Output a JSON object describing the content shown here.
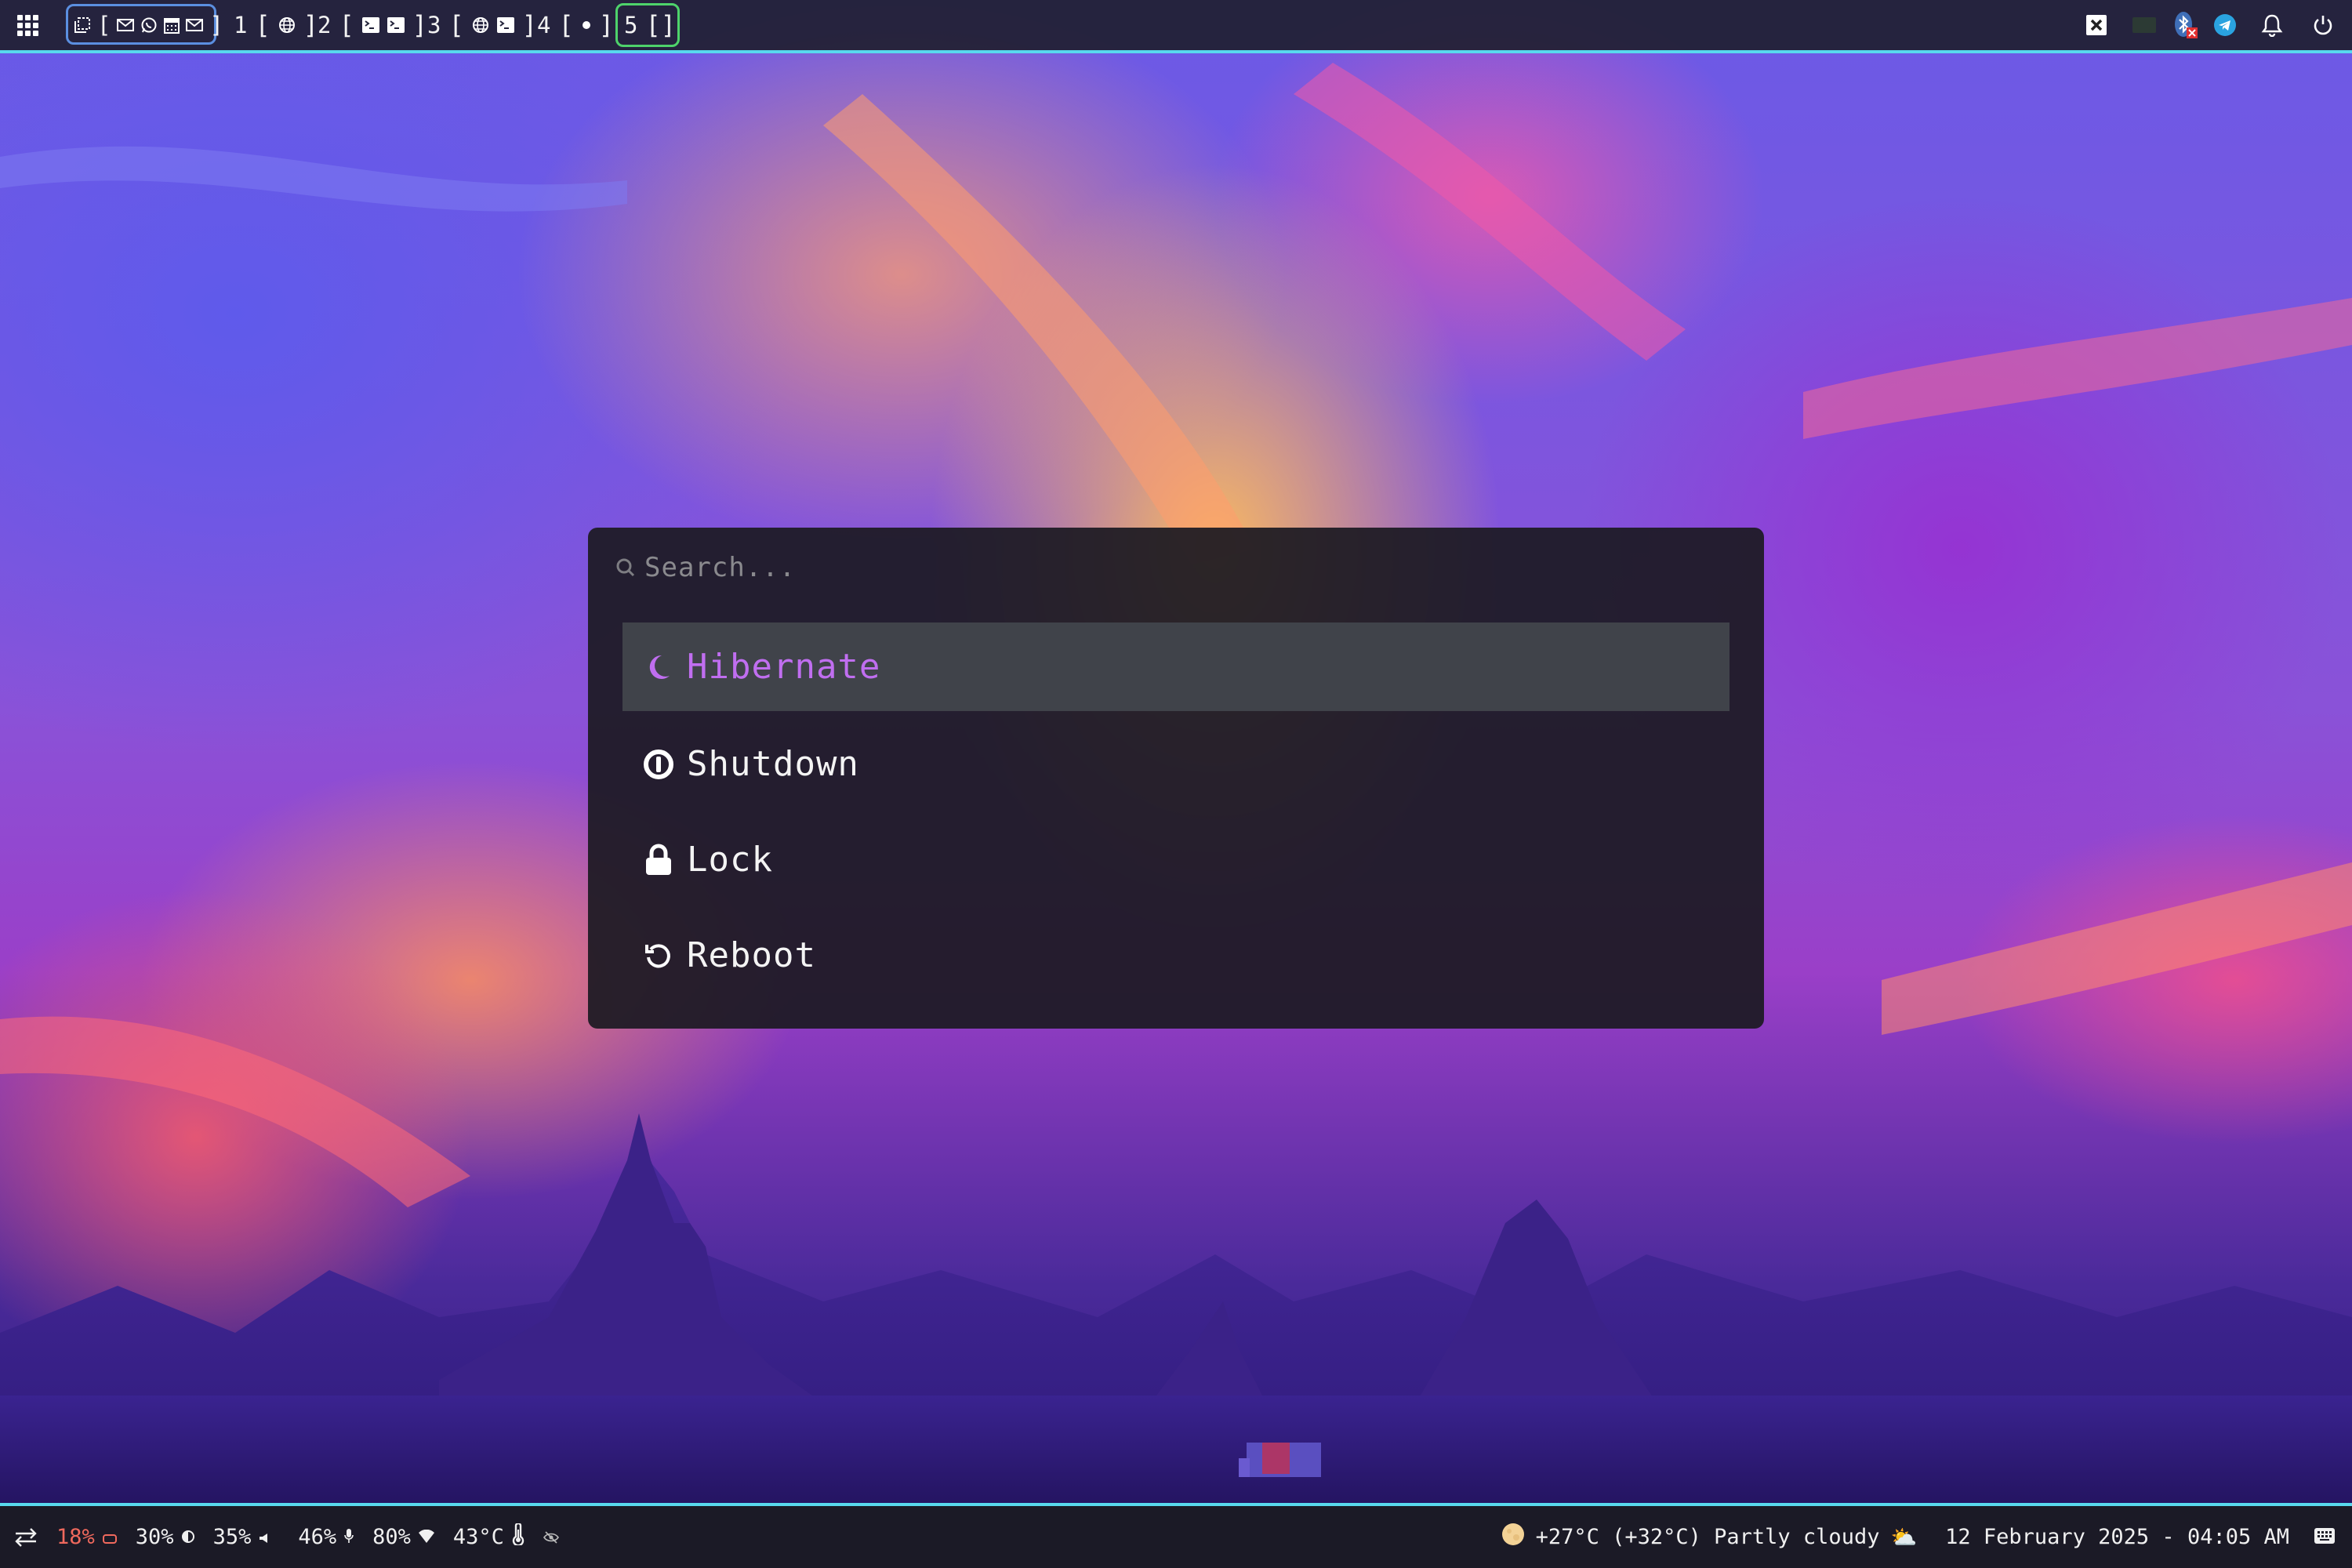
{
  "topbar": {
    "launcher_icon": "apps-grid-icon",
    "scratchpad": {
      "icon": "scratchpad-icon",
      "apps": [
        "mail-icon",
        "whatsapp-icon",
        "calendar-icon",
        "mail-icon"
      ],
      "bracket_open": "[",
      "bracket_close": "]"
    },
    "workspaces": [
      {
        "number": "1",
        "apps": [
          "globe-icon"
        ],
        "active": false
      },
      {
        "number": "2",
        "apps": [
          "terminal-icon",
          "terminal-icon"
        ],
        "active": false
      },
      {
        "number": "3",
        "apps": [
          "globe-icon",
          "terminal-icon"
        ],
        "active": false
      },
      {
        "number": "4",
        "apps": [
          "dot-icon"
        ],
        "active": false
      },
      {
        "number": "5",
        "apps": [],
        "active": true
      }
    ],
    "tray": [
      "close-window-icon",
      "keyboard-layout-icon",
      "bluetooth-disconnected-icon",
      "telegram-icon",
      "notification-bell-icon",
      "power-icon"
    ],
    "colors": {
      "scratch_border": "#5b8fe0",
      "active_border": "#4ed36b",
      "accent_line": "#58d8ee"
    }
  },
  "menu": {
    "search_placeholder": "Search...",
    "search_value": "",
    "items": [
      {
        "label": "Hibernate",
        "icon": "moon-icon",
        "selected": true
      },
      {
        "label": "Shutdown",
        "icon": "power-off-icon",
        "selected": false
      },
      {
        "label": "Lock",
        "icon": "lock-icon",
        "selected": false
      },
      {
        "label": "Reboot",
        "icon": "reboot-icon",
        "selected": false
      }
    ],
    "colors": {
      "selected_text": "#c06ef0",
      "selected_bg": "#40434a"
    }
  },
  "bottombar": {
    "left": {
      "swap_icon": "swap-arrows-icon",
      "battery": {
        "value": "18%",
        "icon": "battery-low-icon"
      },
      "brightness": {
        "value": "30%",
        "icon": "brightness-icon"
      },
      "volume": {
        "value": "35%",
        "icon": "speaker-icon"
      },
      "microphone": {
        "value": "46%",
        "icon": "microphone-icon"
      },
      "wifi": {
        "value": "80%",
        "icon": "wifi-icon"
      },
      "temperature": {
        "value": "43°C",
        "icon": "thermometer-icon"
      },
      "idle_inhibitor_icon": "eye-off-icon"
    },
    "right": {
      "weather_icon": "moon-full-icon",
      "weather_text": "+27°C (+32°C) Partly cloudy",
      "weather_emoji": "⛅",
      "datetime": "12 February 2025 - 04:05 AM",
      "keyboard_icon": "keyboard-icon"
    },
    "colors": {
      "warning": "#f0695d"
    }
  }
}
